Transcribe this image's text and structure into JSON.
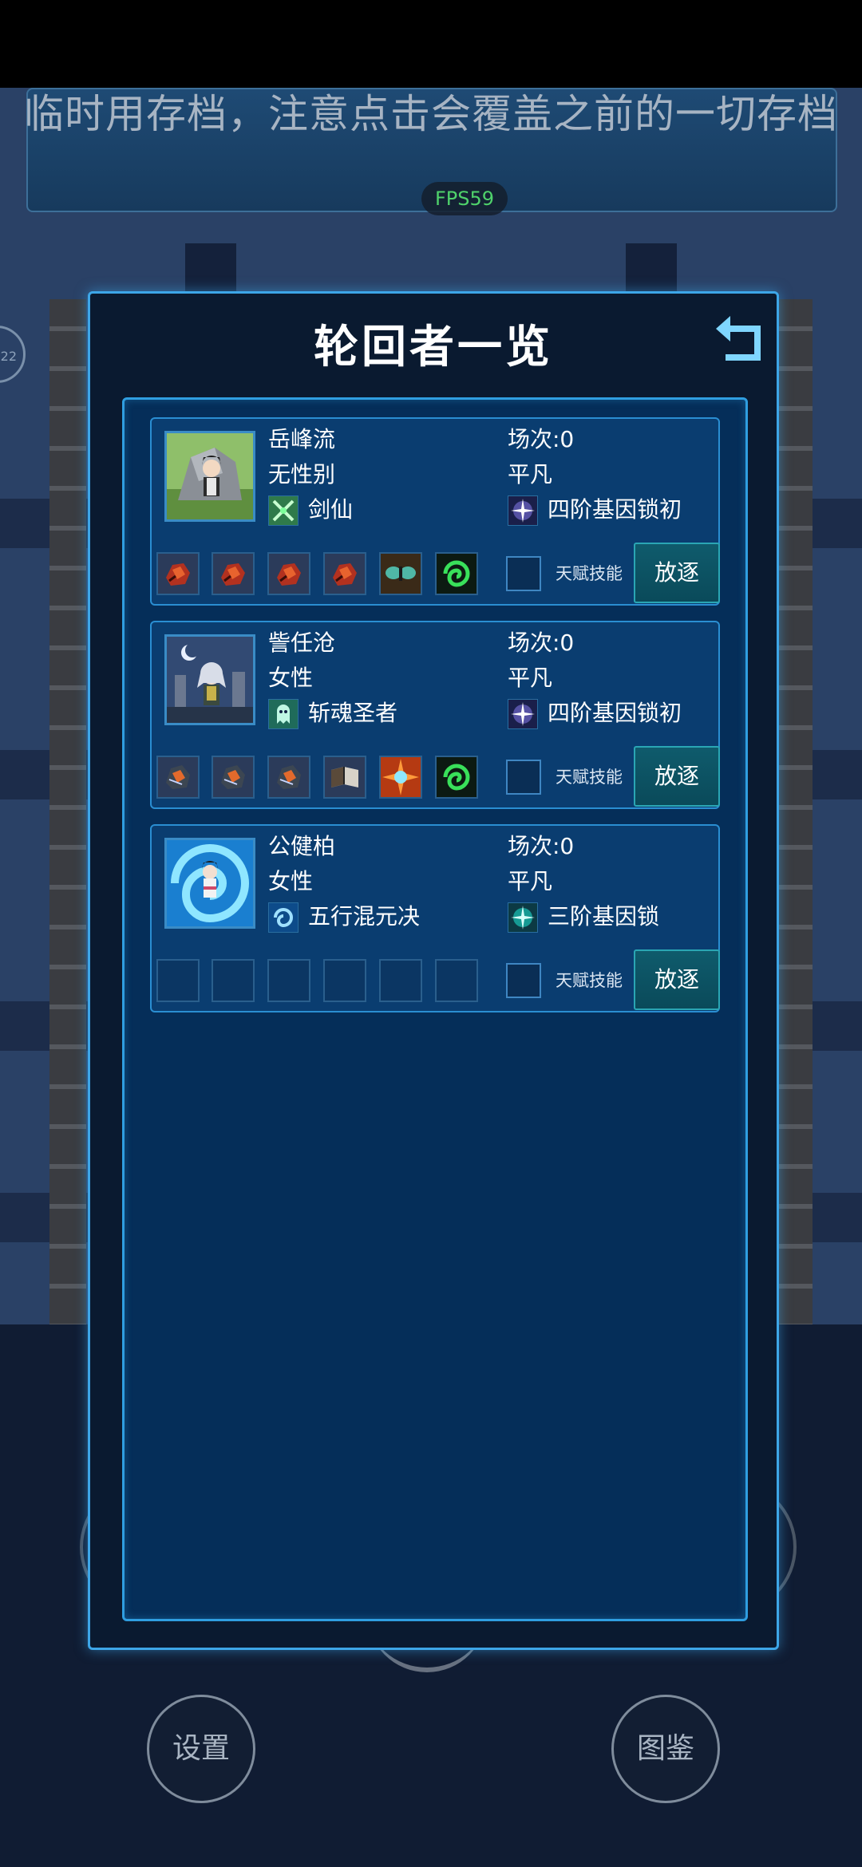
{
  "banner": {
    "text": "临时用存档，注意点击会覆盖之前的一切存档",
    "fps": "FPS59",
    "side_counter": "22"
  },
  "bottom_buttons": {
    "settings": "设置",
    "codex": "图鉴"
  },
  "dialog": {
    "title": "轮回者一览",
    "talent_label": "天赋技能",
    "exile_label": "放逐",
    "characters": [
      {
        "name": "岳峰流",
        "gender": "无性别",
        "skill": "剑仙",
        "rounds": "场次:0",
        "grade": "平凡",
        "gene": "四阶基因锁初",
        "skill_icon": "crossed-swords-icon",
        "gene_icon": "white-star-burst-icon",
        "portrait": "swordsman-on-rock",
        "items": [
          "red-ore-icon",
          "red-ore-icon",
          "red-ore-icon",
          "red-ore-icon",
          "moth-icon",
          "green-vortex-icon"
        ]
      },
      {
        "name": "訾任沧",
        "gender": "女性",
        "skill": "斩魂圣者",
        "rounds": "场次:0",
        "grade": "平凡",
        "gene": "四阶基因锁初",
        "skill_icon": "ghost-icon",
        "gene_icon": "white-star-burst-icon",
        "portrait": "silver-hair-moon",
        "items": [
          "dark-ore-icon",
          "dark-ore-icon",
          "dark-ore-icon",
          "book-icon",
          "orange-burst-icon",
          "green-vortex-icon"
        ]
      },
      {
        "name": "公健柏",
        "gender": "女性",
        "skill": "五行混元决",
        "rounds": "场次:0",
        "grade": "平凡",
        "gene": "三阶基因锁",
        "skill_icon": "blue-swirl-icon",
        "gene_icon": "teal-star-burst-icon",
        "portrait": "blue-whirlpool",
        "items": [
          "empty",
          "empty",
          "empty",
          "empty",
          "empty",
          "empty"
        ]
      }
    ]
  },
  "colors": {
    "accent": "#3da6e8",
    "panel": "#052e59",
    "card": "#0a3d70",
    "button": "#0f5b6c",
    "fps": "#4fd26b"
  }
}
